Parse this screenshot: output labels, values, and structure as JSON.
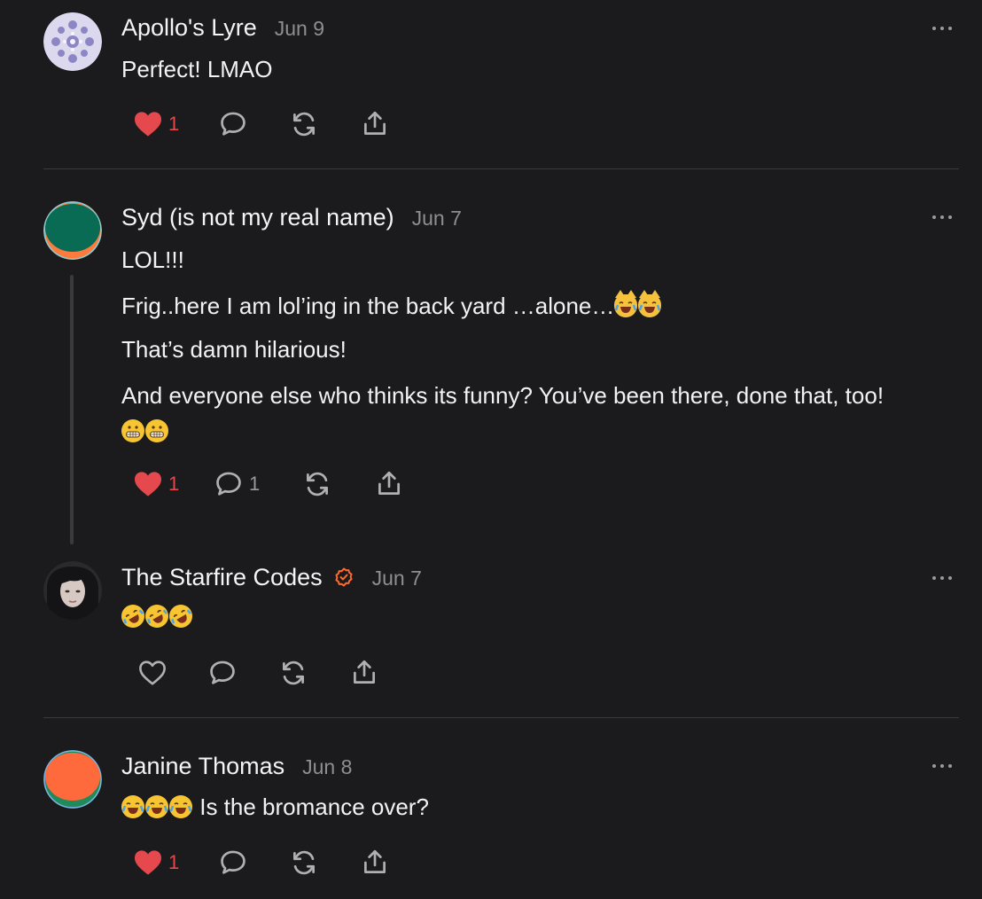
{
  "comments": [
    {
      "author": "Apollo's Lyre",
      "date": "Jun 9",
      "lines": [
        "Perfect! LMAO"
      ],
      "likes": "1",
      "liked": true,
      "replies": ""
    },
    {
      "author": "Syd (is not my real name)",
      "date": "Jun 7",
      "lines": [
        "LOL!!!",
        "Frig..here I am lol’ing in the back yard …alone…",
        "That’s damn hilarious!",
        "And everyone else who thinks its funny? You’ve been there, done that, too!"
      ],
      "emojis": [
        "crying-laughing-cat",
        "crying-laughing-cat",
        "grimacing-face",
        "grimacing-face"
      ],
      "likes": "1",
      "liked": true,
      "replies": "1"
    },
    {
      "author": "The Starfire Codes",
      "date": "Jun 7",
      "verified": true,
      "emojis": [
        "rolling-on-floor-laughing",
        "rolling-on-floor-laughing",
        "rolling-on-floor-laughing"
      ],
      "likes": "",
      "liked": false,
      "replies": ""
    },
    {
      "author": "Janine Thomas",
      "date": "Jun 8",
      "lines": [
        "Is the bromance over?"
      ],
      "emojis": [
        "face-with-tears-of-joy",
        "face-with-tears-of-joy",
        "face-with-tears-of-joy"
      ],
      "likes": "1",
      "liked": true,
      "replies": ""
    }
  ],
  "colors": {
    "background": "#1b1b1d",
    "like": "#e5484d",
    "muted": "#9a9a9e",
    "verified": "#ff6b2c"
  },
  "icons": [
    "heart-icon",
    "comment-icon",
    "restack-icon",
    "share-icon",
    "more-icon",
    "verified-icon"
  ]
}
